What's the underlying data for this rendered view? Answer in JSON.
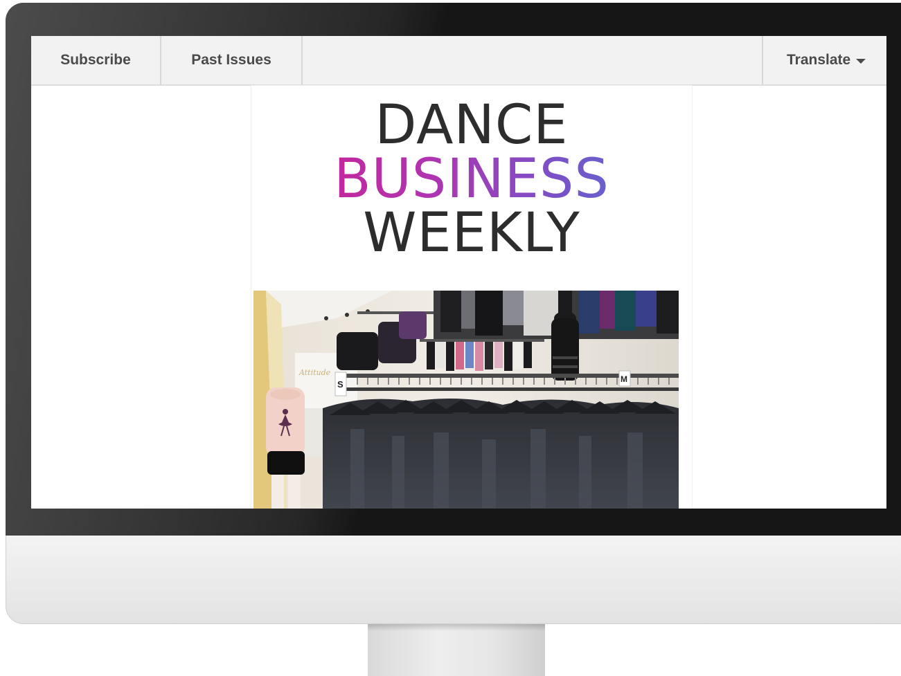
{
  "nav": {
    "subscribe_label": "Subscribe",
    "past_issues_label": "Past Issues",
    "translate_label": "Translate"
  },
  "logo": {
    "line1": "DANCE",
    "line2": "BUSINESS",
    "line3": "WEEKLY"
  },
  "colors": {
    "nav_bg": "#f2f2f2",
    "logo_dark": "#2d2d2d",
    "logo_gradient_start": "#d21f8e",
    "logo_gradient_end": "#4a78d8",
    "bezel": "#161616"
  },
  "photo": {
    "subject": "dancewear-store-racks-photo",
    "size_tags": [
      "S",
      "M"
    ]
  }
}
